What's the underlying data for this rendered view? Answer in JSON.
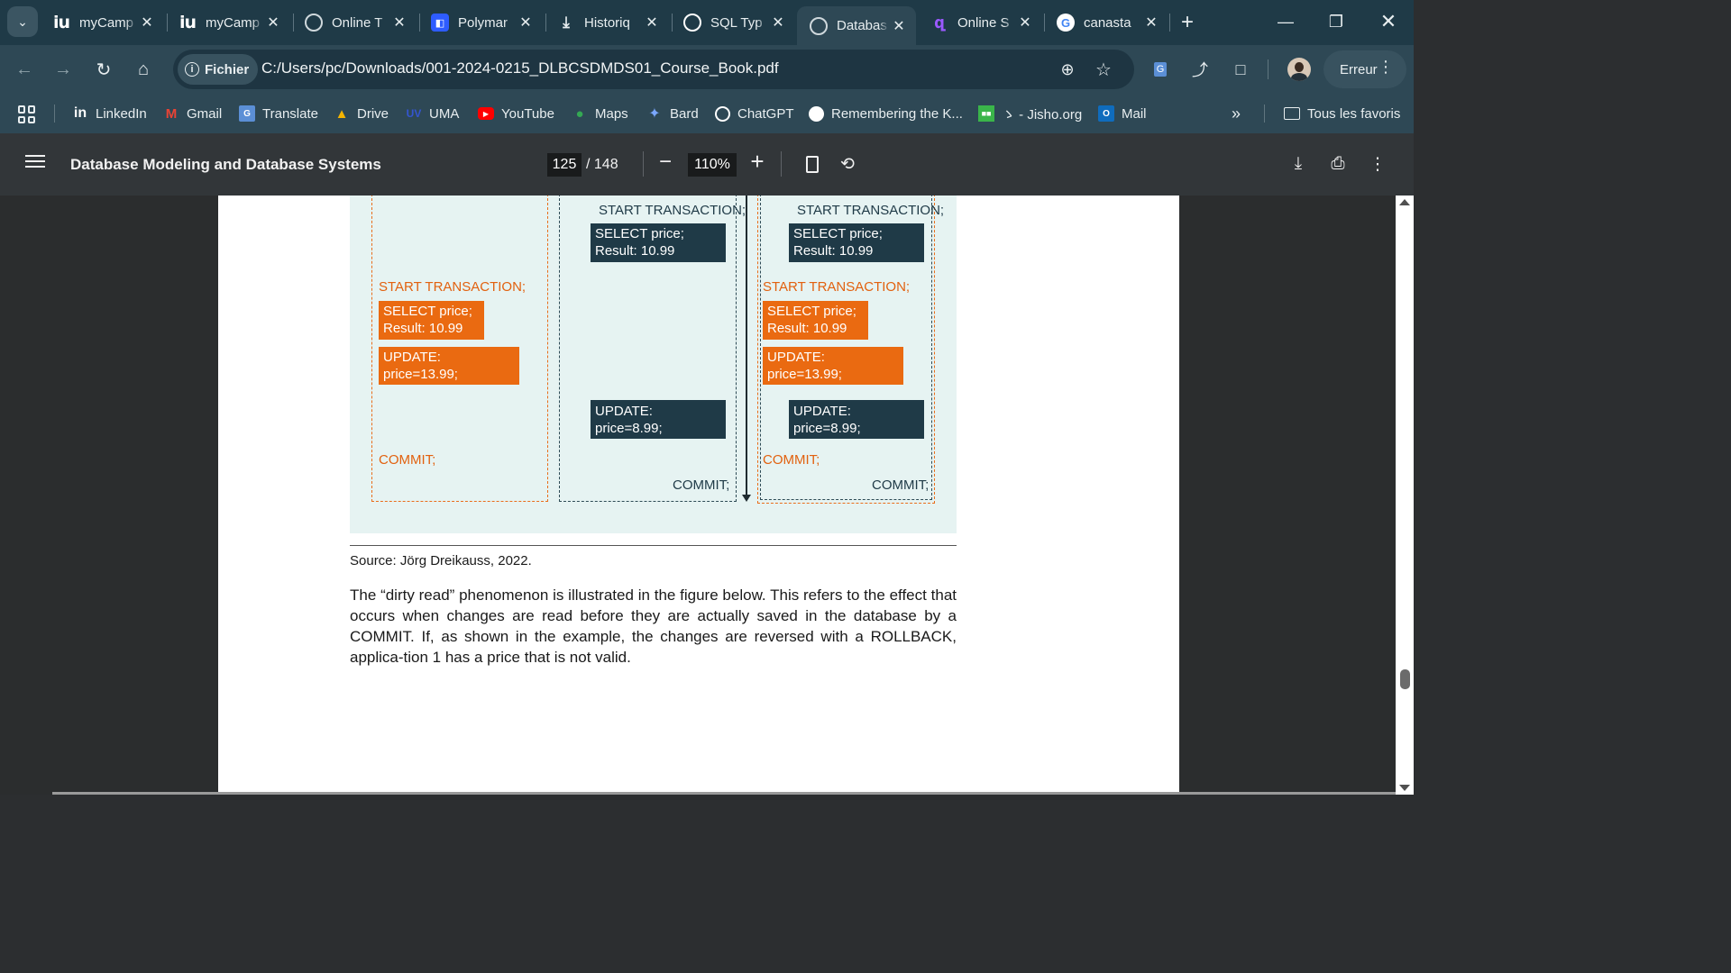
{
  "tabs": [
    {
      "title": "myCamp",
      "icon": "iu-icon"
    },
    {
      "title": "myCamp",
      "icon": "iu-icon"
    },
    {
      "title": "Online T",
      "icon": "globe-icon"
    },
    {
      "title": "Polymar",
      "icon": "polymarket-icon"
    },
    {
      "title": "Historiq",
      "icon": "download-icon"
    },
    {
      "title": "SQL Typ",
      "icon": "chatgpt-icon"
    },
    {
      "title": "Databas",
      "icon": "globe-icon",
      "active": true
    },
    {
      "title": "Online S",
      "icon": "online-s-icon"
    },
    {
      "title": "canasta",
      "icon": "google-icon"
    }
  ],
  "toolbar": {
    "site_label": "Fichier",
    "url": "C:/Users/pc/Downloads/001-2024-0215_DLBCSDMDS01_Course_Book.pdf",
    "profile_status": "Erreur"
  },
  "bookmarks": [
    {
      "label": "LinkedIn",
      "icon": "linkedin-icon"
    },
    {
      "label": "Gmail",
      "icon": "gmail-icon"
    },
    {
      "label": "Translate",
      "icon": "translate-icon"
    },
    {
      "label": "Drive",
      "icon": "drive-icon"
    },
    {
      "label": "UMA",
      "icon": "uma-icon"
    },
    {
      "label": "YouTube",
      "icon": "youtube-icon"
    },
    {
      "label": "Maps",
      "icon": "maps-icon"
    },
    {
      "label": "Bard",
      "icon": "bard-icon"
    },
    {
      "label": "ChatGPT",
      "icon": "chatgpt-icon"
    },
    {
      "label": "Remembering the K...",
      "icon": "globe-icon"
    },
    {
      "label": "ゝ - Jisho.org",
      "icon": "jisho-icon"
    },
    {
      "label": "Mail",
      "icon": "outlook-icon"
    }
  ],
  "bookmarks_folder": "Tous les favoris",
  "pdf": {
    "title": "Database Modeling and Database Systems",
    "current_page": "125",
    "total_pages": "/ 148",
    "zoom": "110%"
  },
  "figure": {
    "lane1": {
      "start": "START TRANSACTION;",
      "select": [
        "SELECT price;",
        "Result: 10.99"
      ],
      "update": "UPDATE: price=13.99;",
      "commit": "COMMIT;"
    },
    "lane2": {
      "start": "START TRANSACTION;",
      "select": [
        "SELECT price;",
        "Result: 10.99"
      ],
      "update": "UPDATE: price=8.99;",
      "commit": "COMMIT;"
    },
    "lane3": {
      "start_dark": "START TRANSACTION;",
      "select_dark": [
        "SELECT price;",
        "Result: 10.99"
      ],
      "start_orange": "START TRANSACTION;",
      "select_orange": [
        "SELECT price;",
        "Result: 10.99"
      ],
      "update_orange": "UPDATE: price=13.99;",
      "update_dark": "UPDATE: price=8.99;",
      "commit_orange": "COMMIT;",
      "commit_dark": "COMMIT;"
    }
  },
  "source": "Source: Jörg Dreikauss, 2022.",
  "body_text": "The “dirty read” phenomenon is illustrated in the figure below. This refers to the effect that occurs when changes are read before they are actually saved in the database by a COMMIT. If, as shown in the example, the changes are reversed with a ROLLBACK, applica-tion 1 has a price that is not valid.",
  "colors": {
    "accent_orange": "#ea6a11",
    "accent_dark": "#1f3a47",
    "figure_bg": "#e6f3f2",
    "chrome_frame": "#1f3a47",
    "pdf_toolbar": "#323639"
  }
}
